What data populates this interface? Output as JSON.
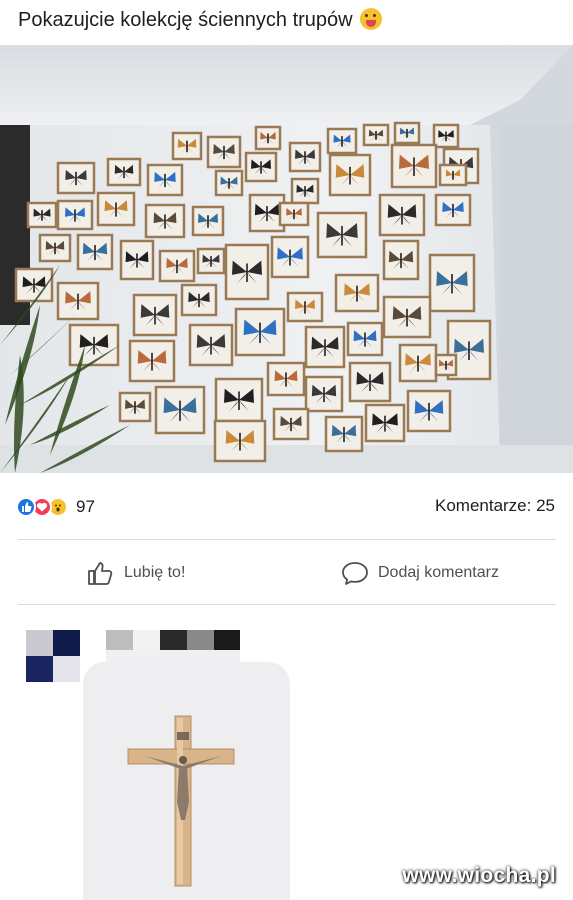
{
  "post": {
    "text": "Pokazujcie kolekcję ściennych trupów",
    "emoji": "tongue-out-face-emoji"
  },
  "photo": {
    "subject": "wall-of-framed-insects",
    "colors": {
      "wall": "#e9ecef",
      "frame": "#9a7a55",
      "mount": "#f2efe9",
      "wing_blue": "#2f6fc4"
    }
  },
  "reactions": {
    "icons": [
      "like-icon",
      "love-icon",
      "wow-icon"
    ],
    "count": "97"
  },
  "comments": {
    "label": "Komentarze: 25"
  },
  "actions": {
    "like_label": "Lubię to!",
    "comment_label": "Dodaj komentarz"
  },
  "comment": {
    "avatar": "pixelated-avatar",
    "name": "pixelated-name",
    "image": "wooden-crucifix-photo"
  },
  "watermark": "www.wiocha.pl",
  "colors": {
    "text": "#1c1e21",
    "muted": "#4b4f56",
    "like_blue": "#1b74e4",
    "love_red": "#f33e58",
    "wow_yellow": "#f7c02d",
    "divider": "#dadde1"
  }
}
